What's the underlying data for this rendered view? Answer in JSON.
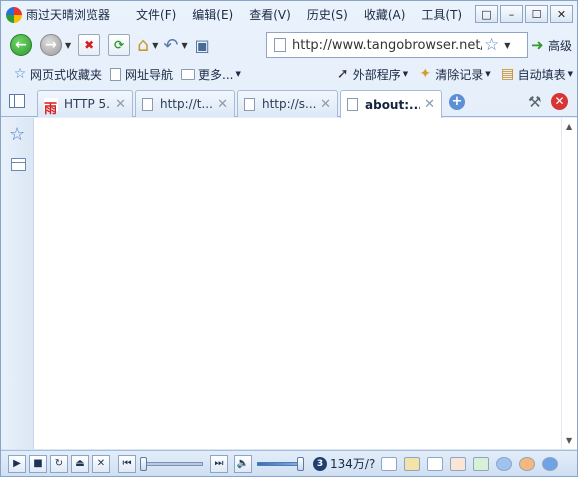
{
  "app": {
    "title": "雨过天晴浏览器"
  },
  "menu": [
    "文件(F)",
    "编辑(E)",
    "查看(V)",
    "历史(S)",
    "收藏(A)",
    "工具(T)"
  ],
  "address": {
    "url": "http://www.tangobrowser.net/c",
    "search_label": "高级"
  },
  "favorites": {
    "left": [
      "网页式收藏夹",
      "网址导航",
      "更多..."
    ],
    "right": [
      "外部程序",
      "清除记录",
      "自动填表"
    ]
  },
  "tabs": [
    {
      "label": "HTTP 5...",
      "active": false,
      "icon": "rain-logo-icon"
    },
    {
      "label": "http://t...",
      "active": false,
      "icon": "page-icon"
    },
    {
      "label": "http://s...",
      "active": false,
      "icon": "page-icon"
    },
    {
      "label": "about:...",
      "active": true,
      "icon": "page-icon"
    }
  ],
  "status": {
    "count_icon_text": "3",
    "count": "134万/?"
  },
  "colors": {
    "accent": "#4a7fc4",
    "close_red": "#d83434",
    "back_green": "#2e9a2c"
  }
}
